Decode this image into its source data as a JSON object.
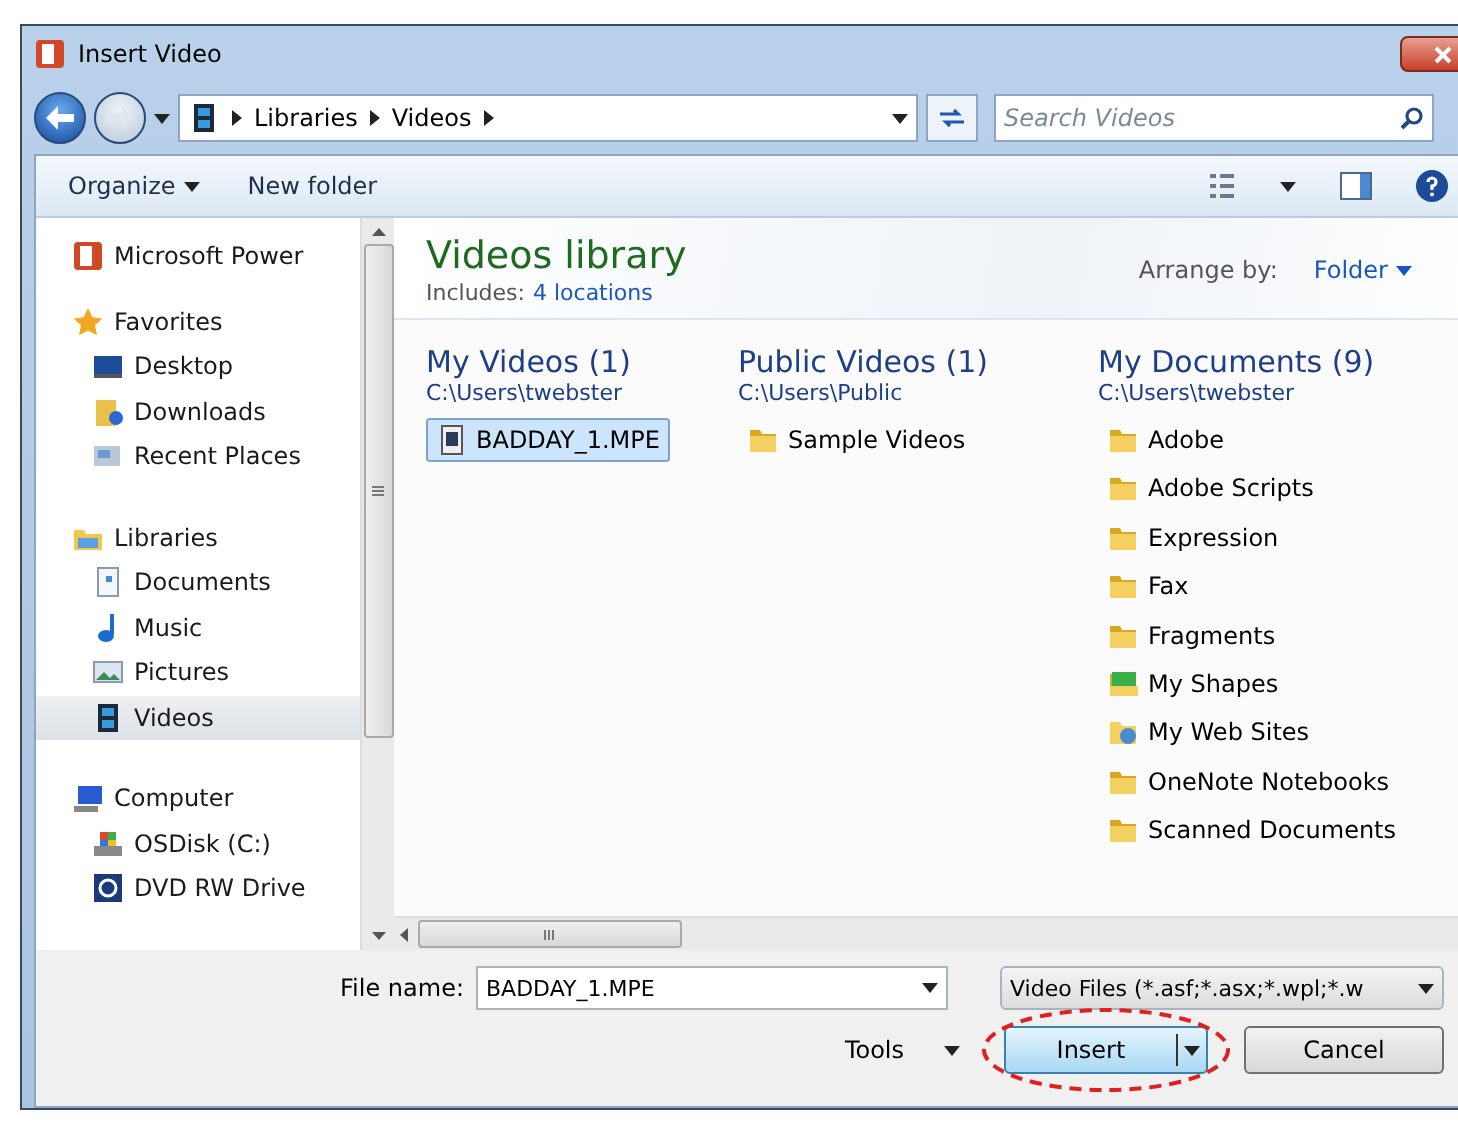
{
  "window": {
    "title": "Insert Video"
  },
  "breadcrumb": [
    "Libraries",
    "Videos"
  ],
  "search": {
    "placeholder": "Search Videos"
  },
  "toolbar": [
    "Organize",
    "New folder"
  ],
  "sidebar": {
    "items": [
      {
        "label": "Microsoft Power",
        "kind": "ppt",
        "selected": false
      },
      {
        "label": "Favorites",
        "kind": "star",
        "selected": false,
        "children": [
          {
            "label": "Desktop",
            "kind": "desktop",
            "selected": false
          },
          {
            "label": "Downloads",
            "kind": "download",
            "selected": false
          },
          {
            "label": "Recent Places",
            "kind": "recent",
            "selected": false
          }
        ]
      },
      {
        "label": "Libraries",
        "kind": "library",
        "selected": false,
        "children": [
          {
            "label": "Documents",
            "kind": "document",
            "selected": false
          },
          {
            "label": "Music",
            "kind": "music",
            "selected": false
          },
          {
            "label": "Pictures",
            "kind": "pictures",
            "selected": false
          },
          {
            "label": "Videos",
            "kind": "video",
            "selected": true
          }
        ]
      },
      {
        "label": "Computer",
        "kind": "computer",
        "selected": false,
        "children": [
          {
            "label": "OSDisk (C:)",
            "kind": "disk",
            "selected": false
          },
          {
            "label": "DVD RW Drive",
            "kind": "dvd",
            "selected": false
          }
        ]
      }
    ]
  },
  "library": {
    "title": "Videos library",
    "includes_label": "Includes:",
    "includes_link": "4 locations",
    "arrange_label": "Arrange by:",
    "arrange_value": "Folder"
  },
  "groups": [
    {
      "title": "My Videos (1)",
      "path": "C:\\Users\\twebster",
      "items": [
        {
          "label": "BADDAY_1.MPE",
          "kind": "file",
          "selected": true
        }
      ]
    },
    {
      "title": "Public Videos (1)",
      "path": "C:\\Users\\Public",
      "items": [
        {
          "label": "Sample Videos",
          "kind": "folder",
          "selected": false
        }
      ]
    },
    {
      "title": "My Documents (9)",
      "path": "C:\\Users\\twebster",
      "items": [
        {
          "label": "Adobe",
          "kind": "folder",
          "selected": false
        },
        {
          "label": "Adobe Scripts",
          "kind": "folder",
          "selected": false
        },
        {
          "label": "Expression",
          "kind": "folder",
          "selected": false
        },
        {
          "label": "Fax",
          "kind": "folder",
          "selected": false
        },
        {
          "label": "Fragments",
          "kind": "folder",
          "selected": false
        },
        {
          "label": "My Shapes",
          "kind": "shapes",
          "selected": false
        },
        {
          "label": "My Web Sites",
          "kind": "web",
          "selected": false
        },
        {
          "label": "OneNote Notebooks",
          "kind": "folder",
          "selected": false
        },
        {
          "label": "Scanned Documents",
          "kind": "folder",
          "selected": false
        }
      ]
    }
  ],
  "file_name": {
    "label": "File name:",
    "value": "BADDAY_1.MPE"
  },
  "file_type": {
    "value": "Video Files (*.asf;*.asx;*.wpl;*.w"
  },
  "tools": "Tools",
  "buttons": [
    {
      "label": "Insert",
      "kind": "split",
      "highlighted": true
    },
    {
      "label": "Cancel",
      "kind": "plain",
      "highlighted": false
    }
  ]
}
